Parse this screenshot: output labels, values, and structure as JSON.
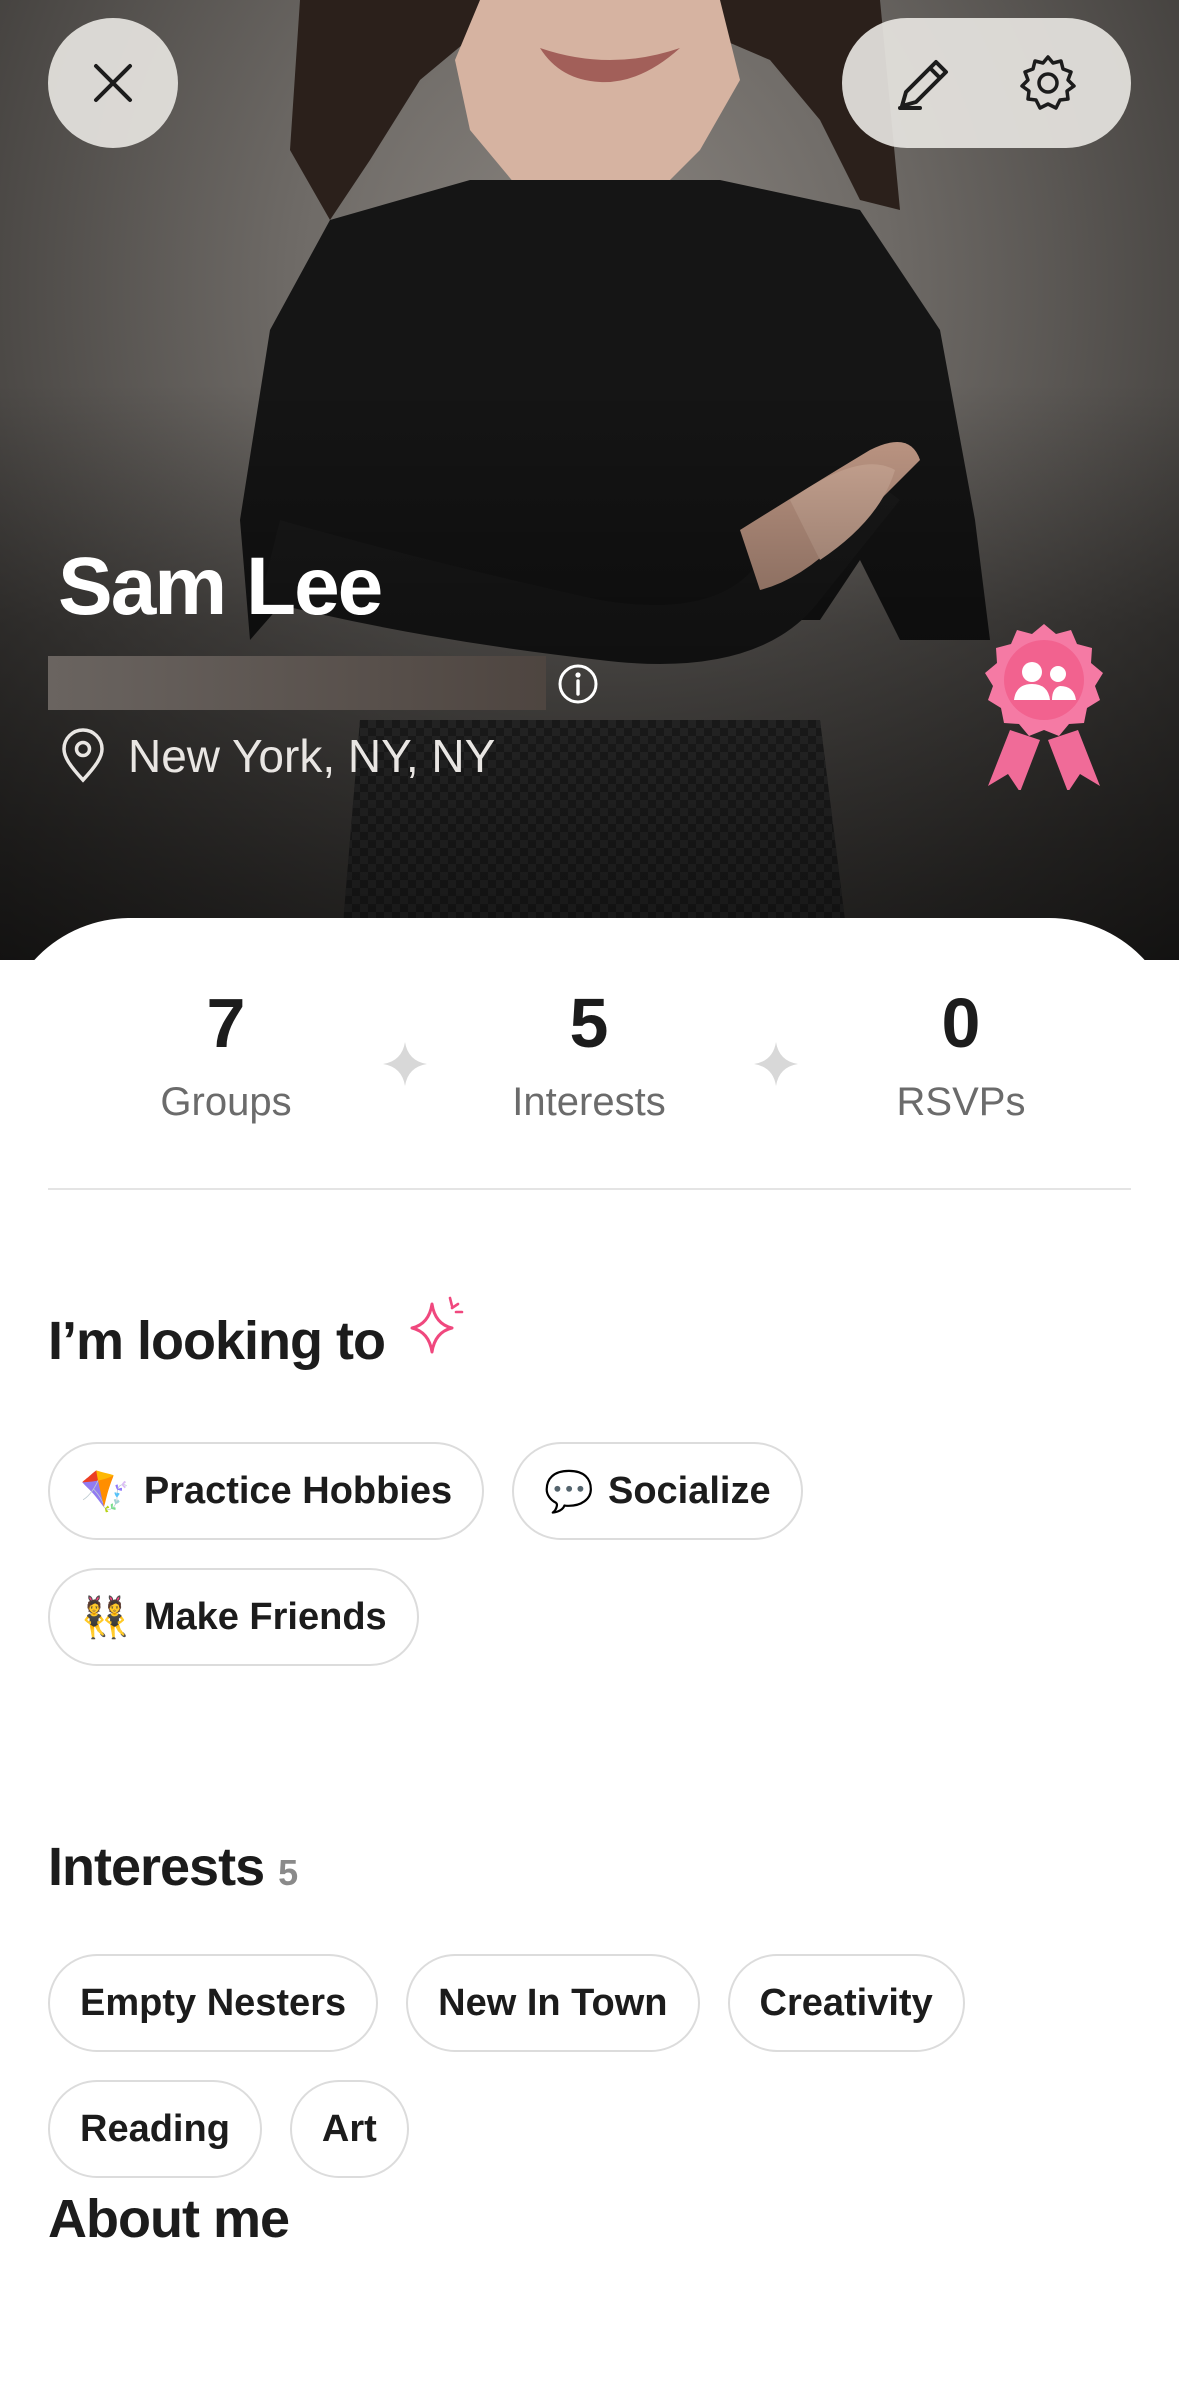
{
  "profile": {
    "name": "Sam Lee",
    "location": "New York, NY, NY"
  },
  "stats": [
    {
      "value": "7",
      "label": "Groups"
    },
    {
      "value": "5",
      "label": "Interests"
    },
    {
      "value": "0",
      "label": "RSVPs"
    }
  ],
  "looking_to": {
    "title": "I’m looking to",
    "chips": [
      {
        "emoji": "🪁",
        "label": "Practice Hobbies"
      },
      {
        "emoji": "💬",
        "label": "Socialize"
      },
      {
        "emoji": "👯",
        "label": "Make Friends"
      }
    ]
  },
  "interests": {
    "title": "Interests",
    "count": "5",
    "chips": [
      "Empty Nesters",
      "New In Town",
      "Creativity",
      "Reading",
      "Art"
    ]
  },
  "about": {
    "title": "About me"
  },
  "colors": {
    "accent_pink": "#f0487e",
    "badge_pink": "#f57aa4",
    "sparkle_gray": "#d8d8d8"
  },
  "icons": [
    "close-icon",
    "pencil-icon",
    "gear-icon",
    "info-icon",
    "location-pin-icon",
    "group-badge-icon",
    "sparkle-icon"
  ]
}
